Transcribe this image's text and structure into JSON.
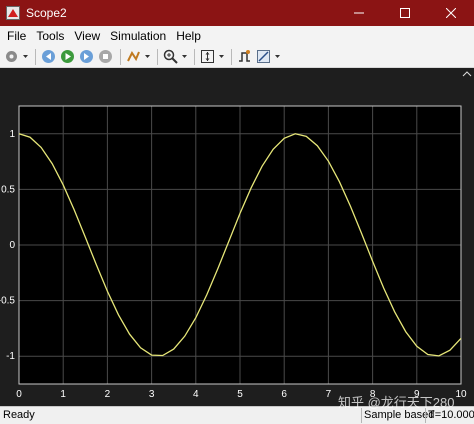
{
  "window": {
    "title": "Scope2",
    "titlebar_color": "#8b1414"
  },
  "menu": [
    "File",
    "Tools",
    "View",
    "Simulation",
    "Help"
  ],
  "toolbar": {
    "buttons": [
      "settings-icon",
      "step-back-icon",
      "run-icon",
      "step-forward-icon",
      "stop-icon",
      "highlight-icon",
      "zoom-icon",
      "fit-axes-icon",
      "trigger-icon",
      "cursor-measure-icon"
    ]
  },
  "chart_data": {
    "type": "line",
    "x": [
      0,
      0.25,
      0.5,
      0.75,
      1,
      1.25,
      1.5,
      1.75,
      2,
      2.25,
      2.5,
      2.75,
      3,
      3.25,
      3.5,
      3.75,
      4,
      4.25,
      4.5,
      4.75,
      5,
      5.25,
      5.5,
      5.75,
      6,
      6.25,
      6.5,
      6.75,
      7,
      7.25,
      7.5,
      7.75,
      8,
      8.25,
      8.5,
      8.75,
      9,
      9.25,
      9.5,
      9.75,
      10
    ],
    "series": [
      {
        "values": [
          1,
          0.969,
          0.878,
          0.732,
          0.54,
          0.315,
          0.071,
          -0.178,
          -0.416,
          -0.628,
          -0.801,
          -0.924,
          -0.99,
          -0.994,
          -0.936,
          -0.82,
          -0.654,
          -0.446,
          -0.211,
          0.036,
          0.284,
          0.512,
          0.709,
          0.861,
          0.96,
          1.0,
          0.977,
          0.893,
          0.754,
          0.568,
          0.347,
          0.105,
          -0.146,
          -0.387,
          -0.602,
          -0.78,
          -0.911,
          -0.985,
          -0.997,
          -0.946,
          -0.839
        ],
        "color": "#e6e678"
      }
    ],
    "xlim": [
      0,
      10
    ],
    "ylim": [
      -1.25,
      1.25
    ],
    "xticks": [
      0,
      1,
      2,
      3,
      4,
      5,
      6,
      7,
      8,
      9,
      10
    ],
    "xtick_labels": [
      "0",
      "1",
      "2",
      "3",
      "4",
      "5",
      "6",
      "7",
      "8",
      "9",
      "10"
    ],
    "yticks": [
      1,
      0.5,
      0,
      -0.5,
      -1
    ],
    "ytick_labels": [
      "1",
      "0.5",
      "0",
      "-0.5",
      "-1"
    ],
    "grid": true,
    "background": "#000000",
    "axis_color": "#ffffff"
  },
  "status": {
    "ready": "Ready",
    "mode": "Sample based",
    "time": "T=10.000"
  },
  "watermark": "知乎 @龙行天下280"
}
